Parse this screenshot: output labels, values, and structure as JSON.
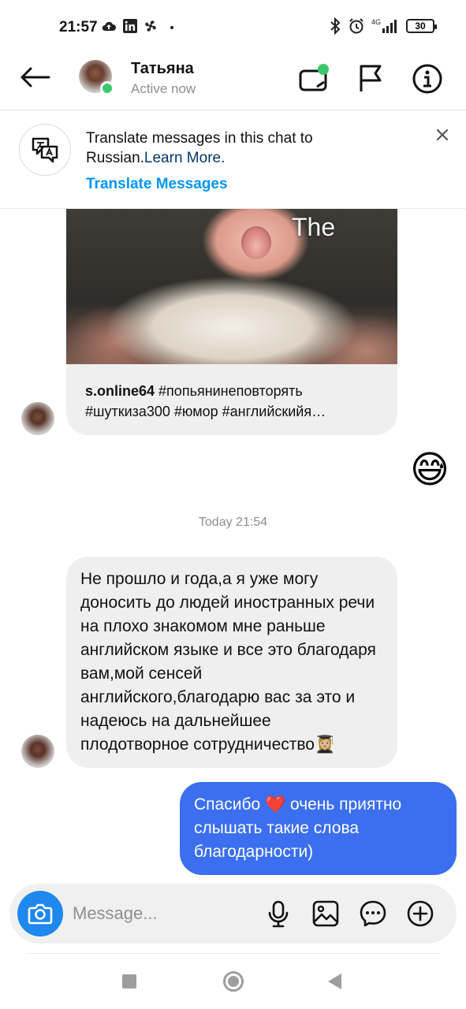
{
  "status_bar": {
    "time": "21:57",
    "battery": "30",
    "network": "4G",
    "icons_left": [
      "cloud-upload-icon",
      "linkedin-icon",
      "fan-icon",
      "dot-icon"
    ],
    "icons_right": [
      "bluetooth-icon",
      "alarm-icon",
      "signal-icon",
      "battery-icon"
    ]
  },
  "header": {
    "contact_name": "Татьяна",
    "contact_status": "Active now",
    "online_color": "#3cc86a",
    "actions": [
      "back-arrow-icon",
      "video-call-icon",
      "flag-icon",
      "info-icon"
    ]
  },
  "translate_banner": {
    "text": "Translate messages in this chat to Russian.",
    "link": "Learn More.",
    "action": "Translate Messages",
    "action_color": "#0095f6"
  },
  "shared_post": {
    "overlay_text": "The",
    "username": "s.online64",
    "caption_line1": "#попьянинеповторять",
    "caption_line2": "#шуткиза300 #юмор #английскийя…"
  },
  "messages": {
    "emoji": "😅",
    "timestamp": "Today 21:54",
    "incoming": "Не прошло и года,а я уже могу доносить до людей иностранных речи на плохо знакомом  мне раньше английском языке и все это благодаря вам,мой сенсей английского,благодарю вас за это и надеюсь на дальнейшее плодотворное сотрудничество👩🏼‍🎓",
    "outgoing": "Спасибо ❤️  очень приятно слышать такие слова благодарности)",
    "outgoing_color": "#3b6ff0"
  },
  "composer": {
    "placeholder": "Message...",
    "icons": [
      "camera-icon",
      "microphone-icon",
      "gallery-icon",
      "sticker-chat-icon",
      "add-icon"
    ],
    "camera_color": "#1e88ee"
  },
  "nav_bar": {
    "icons": [
      "recents-square-icon",
      "home-circle-icon",
      "back-triangle-icon"
    ]
  }
}
